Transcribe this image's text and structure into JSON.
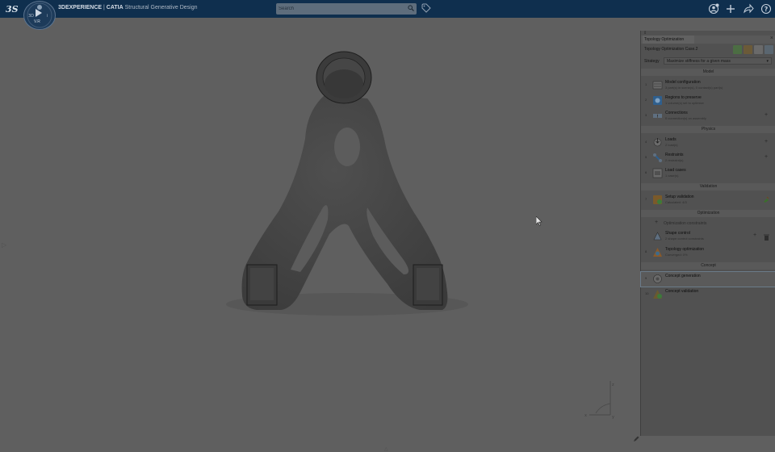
{
  "app": {
    "brand": "3DEXPERIENCE",
    "separator": " | ",
    "product": "CATIA",
    "module": " Structural Generative Design",
    "compass_label": "V.R"
  },
  "search": {
    "placeholder": "Search",
    "value": ""
  },
  "panel": {
    "tab_title": "Topology Optimization",
    "case_name": "Topology Optimization Case.2",
    "strategy_label": "Strategy",
    "strategy_value": "Maximize stiffness for a given mass",
    "sections": {
      "model": "Model",
      "physics": "Physics",
      "validation": "Validation",
      "optimization": "Optimization",
      "concept": "Concept"
    },
    "steps": [
      {
        "num": "1",
        "title": "Model configuration",
        "sub": "3 part(s) in scene(s), 0 contact(s) part(s)"
      },
      {
        "num": "2",
        "title": "Regions to preserve",
        "sub": "1 volume(s) set to optimize"
      },
      {
        "num": "3",
        "title": "Connections",
        "sub": "0 connection(s) on assembly"
      },
      {
        "num": "4",
        "title": "Loads",
        "sub": "2 load(s)"
      },
      {
        "num": "5",
        "title": "Restraints",
        "sub": "2 restraint(s)"
      },
      {
        "num": "6",
        "title": "Load cases",
        "sub": "1 case(s)"
      },
      {
        "num": "7",
        "title": "Setup validation",
        "sub": "Calculated: 4/3"
      },
      {
        "num": "",
        "title": "Shape control",
        "sub": "2 shape control constraints"
      },
      {
        "num": "8",
        "title": "Topology optimization",
        "sub": "Converged: 0%"
      },
      {
        "num": "9",
        "title": "Concept generation",
        "sub": ""
      },
      {
        "num": "10",
        "title": "Concept validation",
        "sub": ""
      }
    ],
    "optimization_constraints": "Optimization constraints"
  },
  "axis": {
    "x": "x",
    "y": "y",
    "z": "z"
  },
  "colors": {
    "topbar": "#0f2f4e",
    "viewport": "#5f5f5f",
    "panel": "#515151",
    "accent": "#2f6ea8"
  }
}
